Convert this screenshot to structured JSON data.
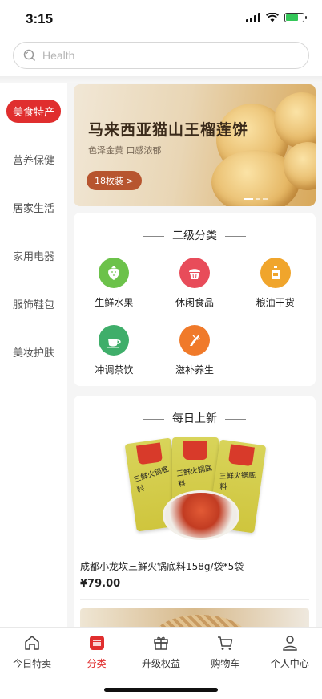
{
  "status": {
    "time": "3:15",
    "battery_level": 0.7
  },
  "search": {
    "placeholder": "Health"
  },
  "sidebar": {
    "items": [
      {
        "label": "美食特产",
        "active": true
      },
      {
        "label": "营养保健"
      },
      {
        "label": "居家生活"
      },
      {
        "label": "家用电器"
      },
      {
        "label": "服饰鞋包"
      },
      {
        "label": "美妆护肤"
      }
    ]
  },
  "banner": {
    "title": "马来西亚猫山王榴莲饼",
    "subtitle": "色泽金黄 口感浓郁",
    "pill": "18枚装 >"
  },
  "subcategories": {
    "title": "二级分类",
    "items": [
      {
        "label": "生鲜水果",
        "icon": "strawberry-icon",
        "color": "#6cc24a"
      },
      {
        "label": "休闲食品",
        "icon": "cupcake-icon",
        "color": "#e84c5a"
      },
      {
        "label": "粮油干货",
        "icon": "oil-bottle-icon",
        "color": "#f0a52c"
      },
      {
        "label": "冲调茶饮",
        "icon": "tea-cup-icon",
        "color": "#3fae6a"
      },
      {
        "label": "滋补养生",
        "icon": "ginseng-icon",
        "color": "#f07a2a"
      }
    ]
  },
  "daily_new": {
    "title": "每日上新",
    "product_name": "成都小龙坎三鲜火锅底料158g/袋*5袋",
    "price": "¥79.00",
    "pack_text": "三鲜火锅底料"
  },
  "tabbar": {
    "tabs": [
      {
        "label": "今日特卖",
        "icon": "home-icon"
      },
      {
        "label": "分类",
        "icon": "category-icon",
        "active": true
      },
      {
        "label": "升级权益",
        "icon": "gift-box-icon"
      },
      {
        "label": "购物车",
        "icon": "cart-icon"
      },
      {
        "label": "个人中心",
        "icon": "person-icon"
      }
    ]
  },
  "colors": {
    "accent": "#e02e2e"
  }
}
